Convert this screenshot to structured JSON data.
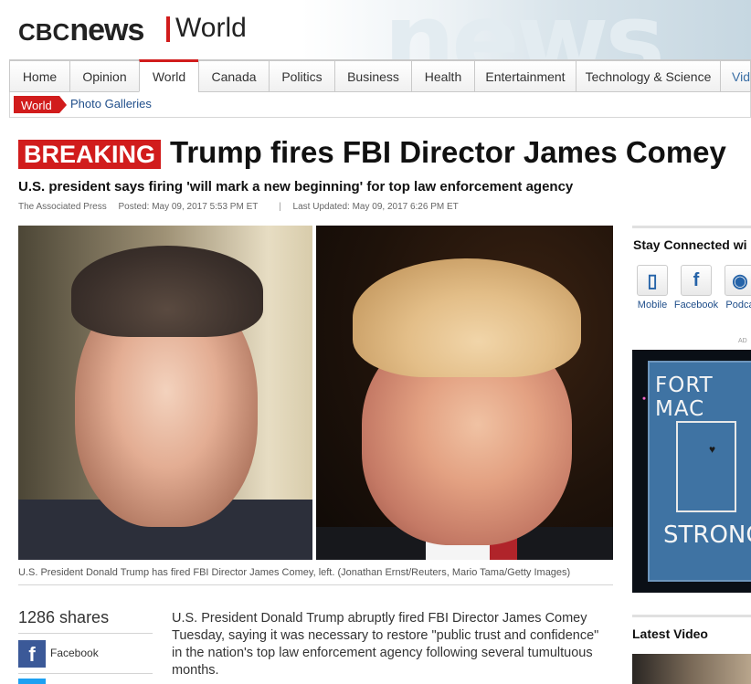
{
  "header": {
    "logo_cbc": "CBC",
    "logo_news": "news",
    "section": "World"
  },
  "nav": {
    "tabs": [
      {
        "label": "Home"
      },
      {
        "label": "Opinion"
      },
      {
        "label": "World",
        "active": true
      },
      {
        "label": "Canada"
      },
      {
        "label": "Politics"
      },
      {
        "label": "Business"
      },
      {
        "label": "Health"
      },
      {
        "label": "Entertainment"
      },
      {
        "label": "Technology & Science"
      },
      {
        "label": "Vid"
      }
    ]
  },
  "subnav": {
    "active": "World",
    "link": "Photo Galleries"
  },
  "article": {
    "badge": "BREAKING",
    "headline": "Trump fires FBI Director James Comey",
    "subhead": "U.S. president says firing 'will mark a new beginning' for top law enforcement agency",
    "source": "The Associated Press",
    "posted": "Posted: May 09, 2017 5:53 PM ET",
    "separator": "|",
    "updated": "Last Updated: May 09, 2017 6:26 PM ET",
    "caption": "U.S. President Donald Trump has fired FBI Director James Comey, left. (Jonathan Ernst/Reuters, Mario Tama/Getty Images)",
    "body": "U.S. President Donald Trump abruptly fired FBI Director James Comey Tuesday, saying it was necessary to restore \"public trust and confidence\" in the nation's top law enforcement agency following several tumultuous months."
  },
  "share": {
    "count": "1286 shares",
    "facebook_label": "Facebook"
  },
  "sidebar": {
    "stay_connected": "Stay Connected wi",
    "social": [
      {
        "label": "Mobile",
        "icon": "mobile-icon"
      },
      {
        "label": "Facebook",
        "icon": "facebook-icon"
      },
      {
        "label": "Podca",
        "icon": "podcast-icon"
      }
    ],
    "ad_label": "AD",
    "ad_top_text": "FORT MAC",
    "ad_bottom_text": "STRONG",
    "latest_video": "Latest Video"
  },
  "colors": {
    "accent": "#d11c1c",
    "link": "#1f4e8a",
    "facebook": "#3b5998"
  }
}
